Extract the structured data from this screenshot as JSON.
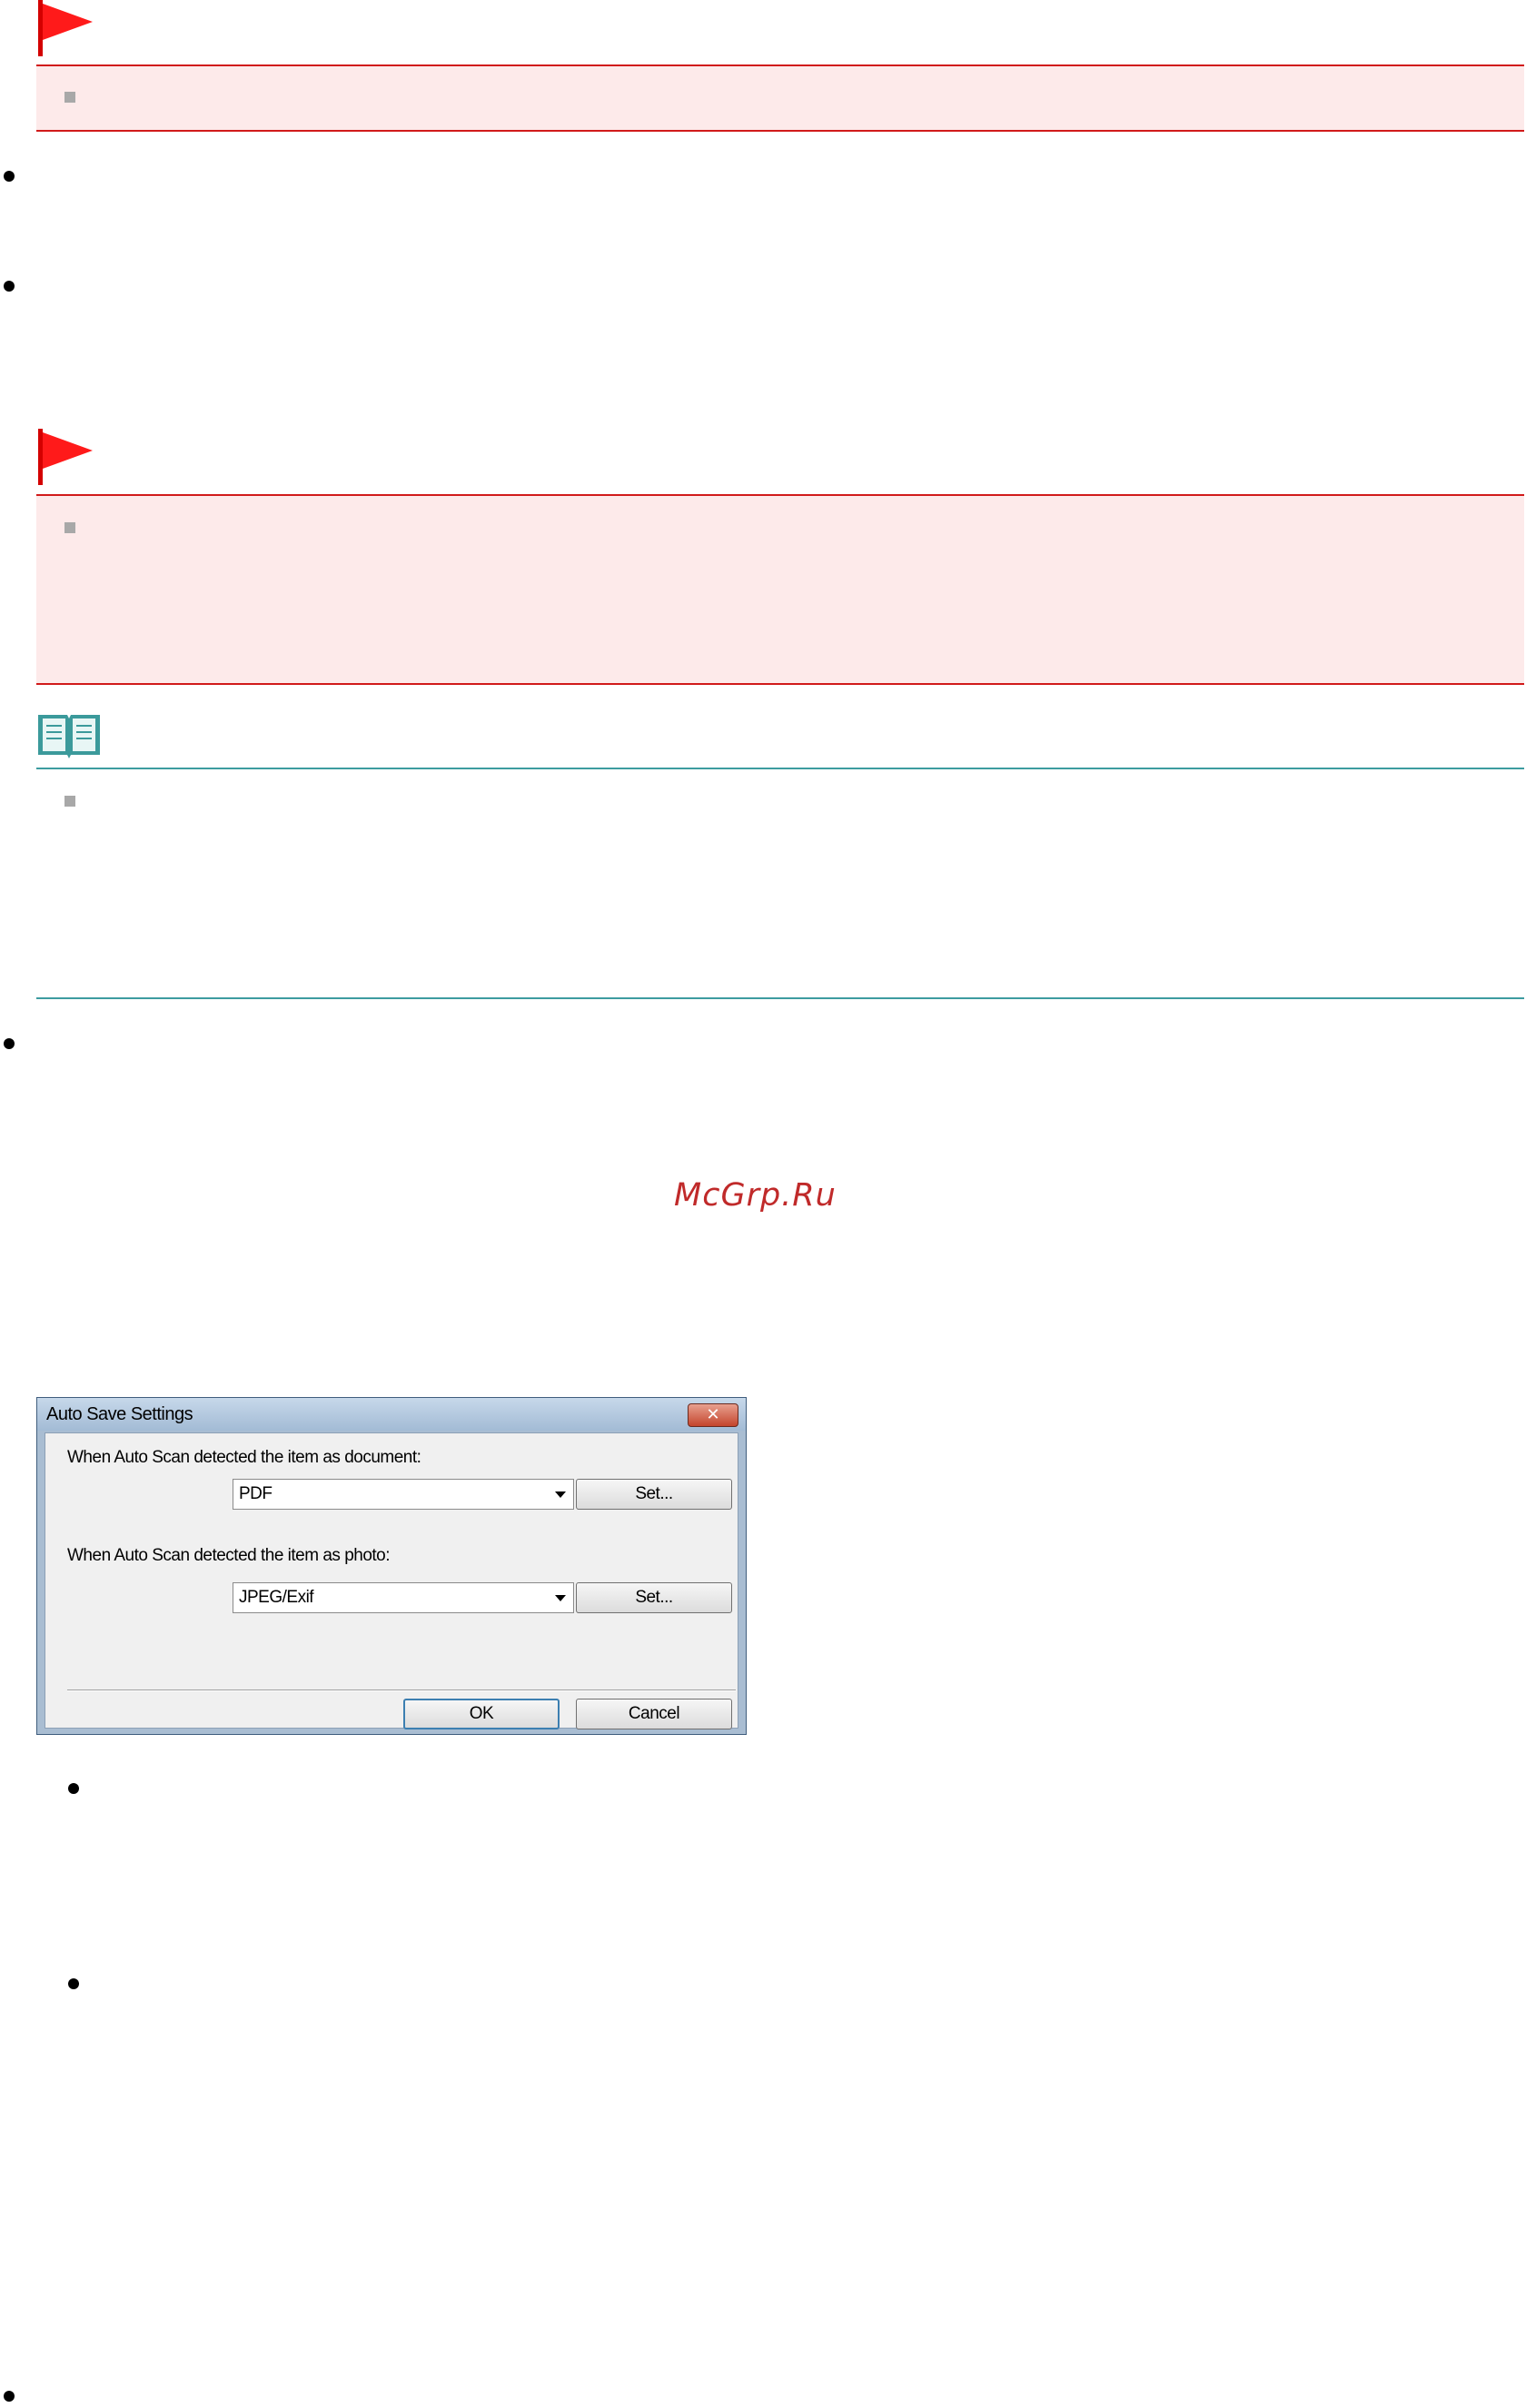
{
  "watermark": "McGrp.Ru",
  "dialog": {
    "title": "Auto Save Settings",
    "close_label": "✕",
    "document_label": "When Auto Scan detected the item as document:",
    "document_format": "PDF",
    "document_set_label": "Set...",
    "photo_label": "When Auto Scan detected the item as photo:",
    "photo_format": "JPEG/Exif",
    "photo_set_label": "Set...",
    "ok_label": "OK",
    "cancel_label": "Cancel"
  }
}
